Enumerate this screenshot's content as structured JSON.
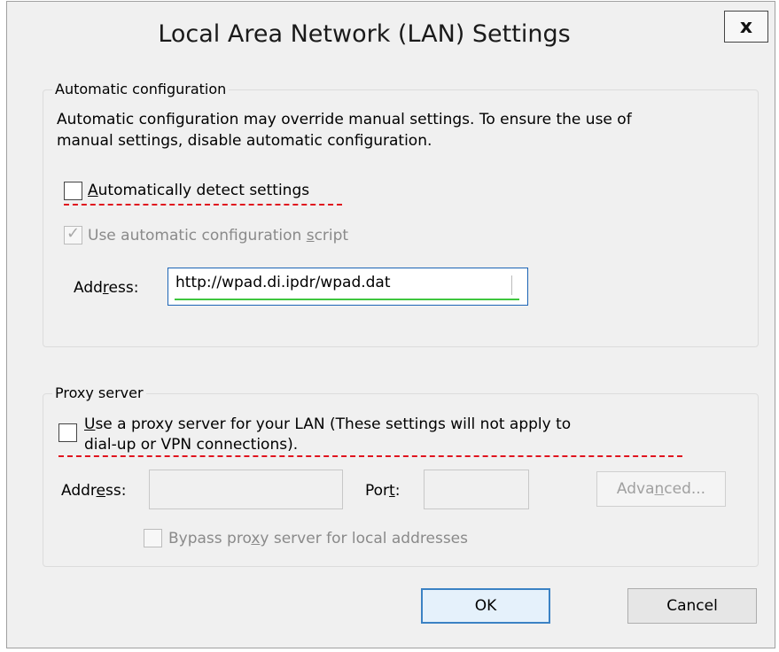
{
  "dialog": {
    "title": "Local Area Network (LAN) Settings",
    "close_label": "x"
  },
  "auto_config": {
    "group_title": "Automatic configuration",
    "description_line1": "Automatic configuration may override manual settings.  To ensure the use of",
    "description_line2": "manual settings, disable automatic configuration.",
    "detect_label_pre": "",
    "detect_label_u": "A",
    "detect_label_post": "utomatically detect settings",
    "detect_checked": false,
    "script_label_pre": "Use automatic configuration ",
    "script_label_u": "s",
    "script_label_post": "cript",
    "script_checked": true,
    "address_label_pre": "Add",
    "address_label_u": "r",
    "address_label_post": "ess:",
    "address_value": "http://wpad.di.ipdr/wpad.dat"
  },
  "proxy": {
    "group_title": "Proxy server",
    "use_proxy_line1_pre": "",
    "use_proxy_line1_u": "U",
    "use_proxy_line1_post": "se a proxy server for your LAN (These settings will not apply to",
    "use_proxy_line2": "dial-up or VPN connections).",
    "use_proxy_checked": false,
    "address_label_pre": "Addr",
    "address_label_u": "e",
    "address_label_post": "ss:",
    "address_value": "",
    "port_label_pre": "Por",
    "port_label_u": "t",
    "port_label_post": ":",
    "port_value": "",
    "advanced_label_pre": "Adva",
    "advanced_label_u": "n",
    "advanced_label_post": "ced...",
    "bypass_label_pre": "Bypass pro",
    "bypass_label_u": "x",
    "bypass_label_post": "y server for local addresses",
    "bypass_checked": false
  },
  "buttons": {
    "ok": "OK",
    "cancel": "Cancel"
  }
}
